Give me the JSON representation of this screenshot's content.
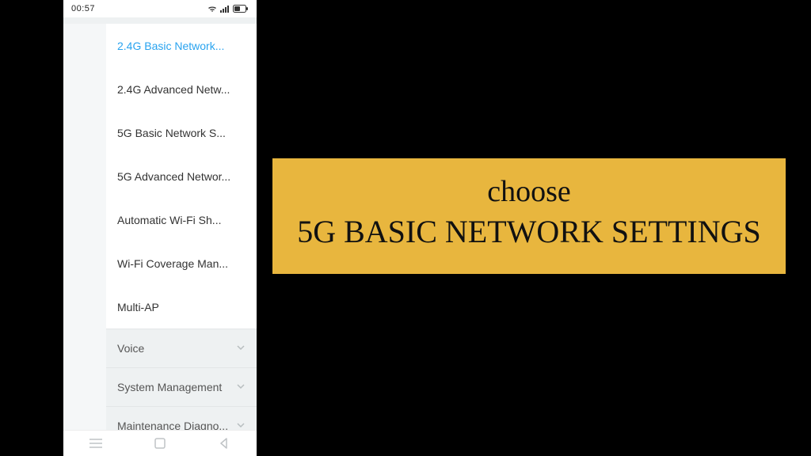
{
  "status": {
    "time": "00:57"
  },
  "menu": {
    "items": [
      {
        "label": "2.4G Basic Network...",
        "active": true
      },
      {
        "label": "2.4G Advanced Netw..."
      },
      {
        "label": "5G Basic Network S..."
      },
      {
        "label": "5G Advanced Networ..."
      },
      {
        "label": "Automatic Wi-Fi Sh..."
      },
      {
        "label": "Wi-Fi Coverage Man..."
      },
      {
        "label": "Multi-AP"
      }
    ],
    "categories": [
      {
        "label": "Voice"
      },
      {
        "label": "System Management"
      },
      {
        "label": "Maintenance Diagno..."
      }
    ]
  },
  "callout": {
    "line1": "choose",
    "line2": "5G BASIC NETWORK SETTINGS"
  }
}
